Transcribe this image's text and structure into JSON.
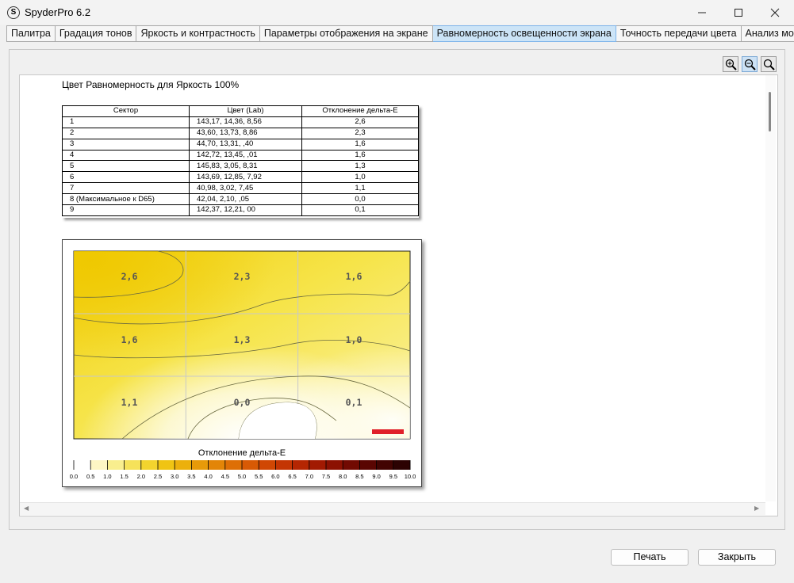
{
  "window": {
    "title": "SpyderPro 6.2",
    "app_icon_letter": "S"
  },
  "tabs": [
    {
      "label": "Палитра",
      "active": false
    },
    {
      "label": "Градация тонов",
      "active": false
    },
    {
      "label": "Яркость и контрастность",
      "active": false
    },
    {
      "label": "Параметры отображения на экране",
      "active": false
    },
    {
      "label": "Равномерность освещенности экрана",
      "active": true
    },
    {
      "label": "Точность передачи цвета",
      "active": false
    },
    {
      "label": "Анализ монитора",
      "active": false
    }
  ],
  "zoom_tools": [
    "zoom-in-icon",
    "zoom-out-icon",
    "zoom-fit-icon"
  ],
  "report": {
    "title": "Цвет Равномерность для Яркость 100%",
    "table": {
      "headers": [
        "Сектор",
        "Цвет (Lab)",
        "Отклонение дельта-E"
      ],
      "rows": [
        {
          "sector": "1",
          "lab": "143,17,  14,36,   8,56",
          "de": "2,6"
        },
        {
          "sector": "2",
          "lab": "43,60,  13,73,   8,86",
          "de": "2,3"
        },
        {
          "sector": "3",
          "lab": "44,70,  13,31,    ,40",
          "de": "1,6"
        },
        {
          "sector": "4",
          "lab": "142,72,  13,45,    ,01",
          "de": "1,6"
        },
        {
          "sector": "5",
          "lab": "145,83,   3,05,   8,31",
          "de": "1,3"
        },
        {
          "sector": "6",
          "lab": "143,69,  12,85,   7,92",
          "de": "1,0"
        },
        {
          "sector": "7",
          "lab": "40,98,   3,02,   7,45",
          "de": "1,1"
        },
        {
          "sector": "8 (Максимальное к D65)",
          "lab": "42,04,   2,10,    ,05",
          "de": "0,0"
        },
        {
          "sector": "9",
          "lab": "142,37,  12,21,     00",
          "de": "0,1"
        }
      ]
    },
    "map_labels": [
      "2,6",
      "2,3",
      "1,6",
      "1,6",
      "1,3",
      "1,0",
      "1,1",
      "0,0",
      "0,1"
    ],
    "scale": {
      "title": "Отклонение дельта-E",
      "ticks": [
        "0.0",
        "0.5",
        "1.0",
        "1.5",
        "2.0",
        "2.5",
        "3.0",
        "3.5",
        "4.0",
        "4.5",
        "5.0",
        "5.5",
        "6.0",
        "6.5",
        "7.0",
        "7.5",
        "8.0",
        "8.5",
        "9.0",
        "9.5",
        "10.0"
      ],
      "colors": [
        "#ffffff",
        "#fdf6c4",
        "#f9ee8e",
        "#f6e25a",
        "#f3d42e",
        "#f0c413",
        "#ecb00c",
        "#e79a09",
        "#e38507",
        "#de6f06",
        "#d85a05",
        "#d04704",
        "#c43503",
        "#b52602",
        "#a21a02",
        "#8c1102",
        "#720a02",
        "#5a0602",
        "#420402",
        "#2c0202"
      ]
    }
  },
  "buttons": {
    "print": "Печать",
    "close": "Закрыть"
  },
  "colors": {
    "accent_tab": "#cce4f7",
    "marker_red": "#e0202a"
  }
}
